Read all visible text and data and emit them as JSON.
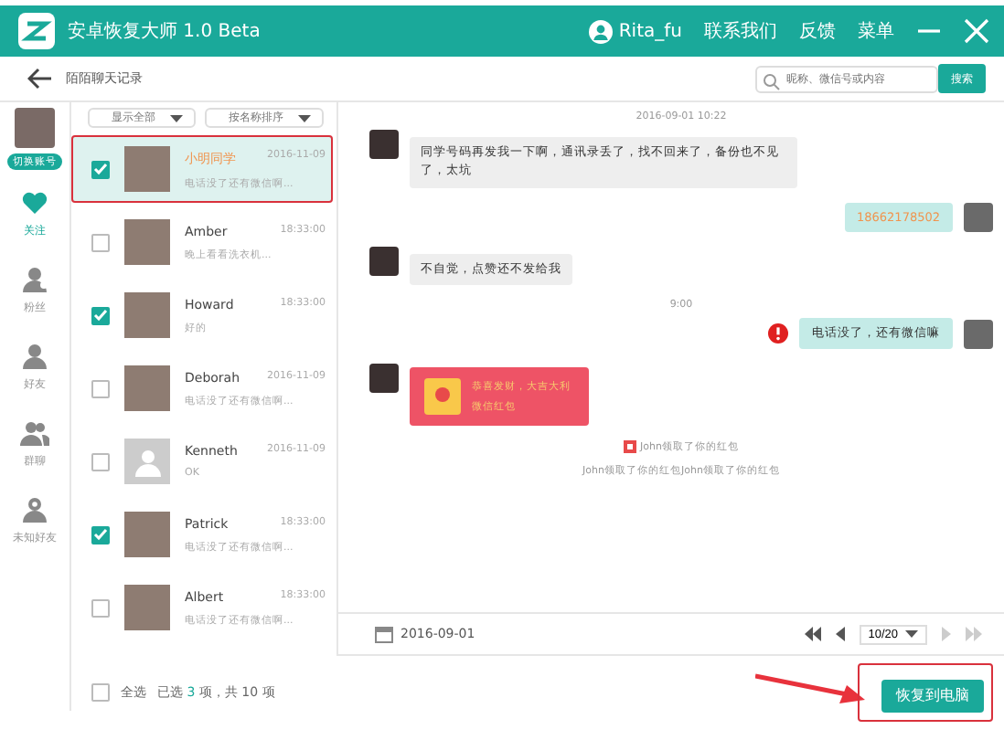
{
  "titlebar": {
    "app_name": "安卓恢复大师 1.0 Beta",
    "user": "Rita_fu",
    "menu": [
      "联系我们",
      "反馈",
      "菜单"
    ]
  },
  "header": {
    "title": "陌陌聊天记录",
    "search_placeholder": "昵称、微信号或内容",
    "search_button": "搜索"
  },
  "account": {
    "switch_label": "切换账号"
  },
  "nav": [
    {
      "kind": "heart",
      "label": "关注",
      "selected": true
    },
    {
      "kind": "fan",
      "label": "粉丝",
      "selected": false
    },
    {
      "kind": "friend",
      "label": "好友",
      "selected": false
    },
    {
      "kind": "group",
      "label": "群聊",
      "selected": false
    },
    {
      "kind": "unknown",
      "label": "未知好友",
      "selected": false
    }
  ],
  "filters": [
    "显示全部",
    "按名称排序"
  ],
  "contacts": [
    {
      "name": "小明同学",
      "time": "2016-11-09",
      "preview": "电话没了还有微信啊...",
      "checked": true,
      "selected": true,
      "kind": "photo"
    },
    {
      "name": "Amber",
      "time": "18:33:00",
      "preview": "晚上看看洗衣机...",
      "checked": false,
      "selected": false,
      "kind": "photo"
    },
    {
      "name": "Howard",
      "time": "18:33:00",
      "preview": "好的",
      "checked": true,
      "selected": false,
      "kind": "photo"
    },
    {
      "name": "Deborah",
      "time": "2016-11-09",
      "preview": "电话没了还有微信啊...",
      "checked": false,
      "selected": false,
      "kind": "photo"
    },
    {
      "name": "Kenneth",
      "time": "2016-11-09",
      "preview": "OK",
      "checked": false,
      "selected": false,
      "kind": "default"
    },
    {
      "name": "Patrick",
      "time": "18:33:00",
      "preview": "电话没了还有微信啊...",
      "checked": true,
      "selected": false,
      "kind": "photo"
    },
    {
      "name": "Albert",
      "time": "18:33:00",
      "preview": "电话没了还有微信啊...",
      "checked": false,
      "selected": false,
      "kind": "photo"
    }
  ],
  "messages": [
    {
      "kind": "time",
      "text": "2016-09-01 10:22"
    },
    {
      "kind": "in",
      "text": "同学号码再发我一下啊，通讯录丢了，找不回来了，备份也不见了，太坑"
    },
    {
      "kind": "out",
      "text": "18662178502",
      "error": false
    },
    {
      "kind": "in",
      "text": "不自觉，点赞还不发给我"
    },
    {
      "kind": "time",
      "text": "9:00"
    },
    {
      "kind": "out",
      "text": "电话没了，还有微信嘛",
      "error": true
    },
    {
      "kind": "redpacket",
      "title": "恭喜发财，大吉大利",
      "subtitle": "微信红包"
    },
    {
      "kind": "notice",
      "text": "John领取了你的红包",
      "icon": true
    },
    {
      "kind": "notice",
      "text": "John领取了你的红包John领取了你的红包",
      "icon": false
    }
  ],
  "chat_footer": {
    "date": "2016-09-01",
    "page": "10/20"
  },
  "footer": {
    "select_all": "全选",
    "select_all_checked": false,
    "selected_prefix": "已选",
    "selected_count": "3",
    "selected_suffix": "项，共 10 项",
    "restore_button": "恢复到电脑"
  }
}
